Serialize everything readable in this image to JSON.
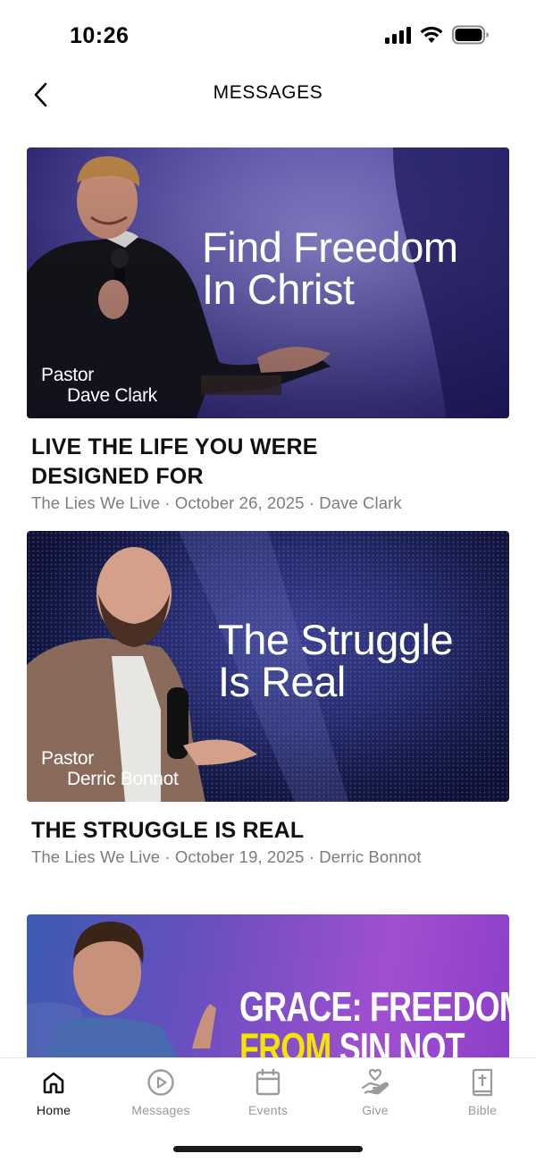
{
  "status_bar": {
    "time": "10:26"
  },
  "header": {
    "title": "MESSAGES"
  },
  "messages": [
    {
      "thumb_title_line1": "Find Freedom",
      "thumb_title_line2": "In Christ",
      "speaker_line1": "Pastor",
      "speaker_line2": "Dave Clark",
      "title": "LIVE THE LIFE YOU WERE DESIGNED FOR",
      "meta": "The Lies We Live · October 26, 2025 · Dave Clark"
    },
    {
      "thumb_title_line1": "The Struggle",
      "thumb_title_line2": "Is Real",
      "speaker_line1": "Pastor",
      "speaker_line2": "Derric Bonnot",
      "title": "THE STRUGGLE IS REAL",
      "meta": "The Lies We Live · October 19, 2025 · Derric Bonnot"
    },
    {
      "thumb_title_line1": "GRACE: FREEDOM",
      "thumb_title_line2_a": "FROM",
      "thumb_title_line2_b": " SIN NOT"
    }
  ],
  "tab_bar": {
    "tabs": [
      {
        "label": "Home",
        "icon": "home-icon",
        "active": true
      },
      {
        "label": "Messages",
        "icon": "play-icon",
        "active": false
      },
      {
        "label": "Events",
        "icon": "calendar-icon",
        "active": false
      },
      {
        "label": "Give",
        "icon": "give-hand-heart-icon",
        "active": false
      },
      {
        "label": "Bible",
        "icon": "bible-icon",
        "active": false
      }
    ]
  },
  "colors": {
    "active": "#111111",
    "inactive": "#9a9a9a",
    "meta": "#7c7c7c",
    "highlight_yellow": "#f5e400"
  }
}
